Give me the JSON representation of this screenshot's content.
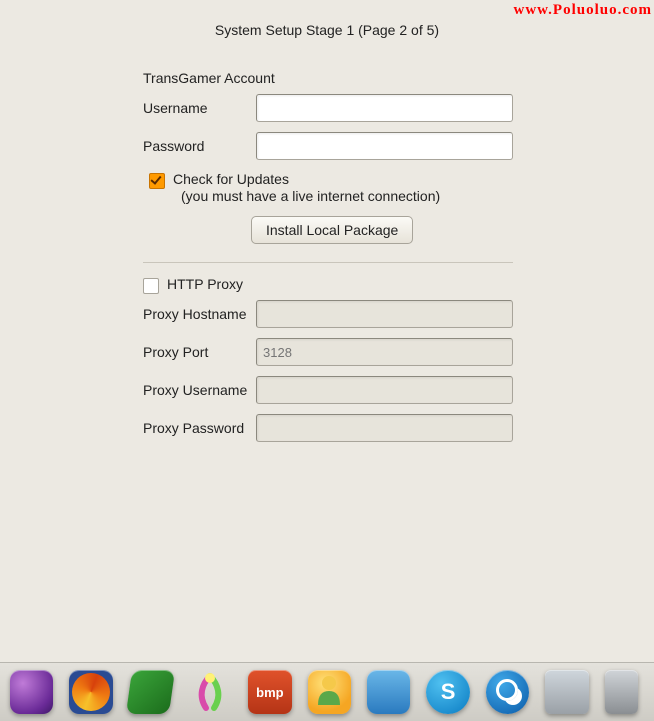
{
  "watermark": "www.Poluoluo.com",
  "title": "System Setup Stage 1 (Page 2 of 5)",
  "account": {
    "heading": "TransGamer Account",
    "username_label": "Username",
    "username_value": "",
    "password_label": "Password",
    "password_value": ""
  },
  "updates": {
    "checked": true,
    "label": "Check for Updates",
    "sub": "(you must have a live internet connection)",
    "install_btn": "Install Local Package"
  },
  "proxy": {
    "enabled": false,
    "checkbox_label": "HTTP Proxy",
    "hostname_label": "Proxy Hostname",
    "hostname_value": "",
    "port_label": "Proxy Port",
    "port_placeholder": "3128",
    "username_label": "Proxy Username",
    "username_value": "",
    "password_label": "Proxy Password",
    "password_value": ""
  },
  "dock": {
    "bmp_label": "bmp",
    "skype_label": "S"
  }
}
